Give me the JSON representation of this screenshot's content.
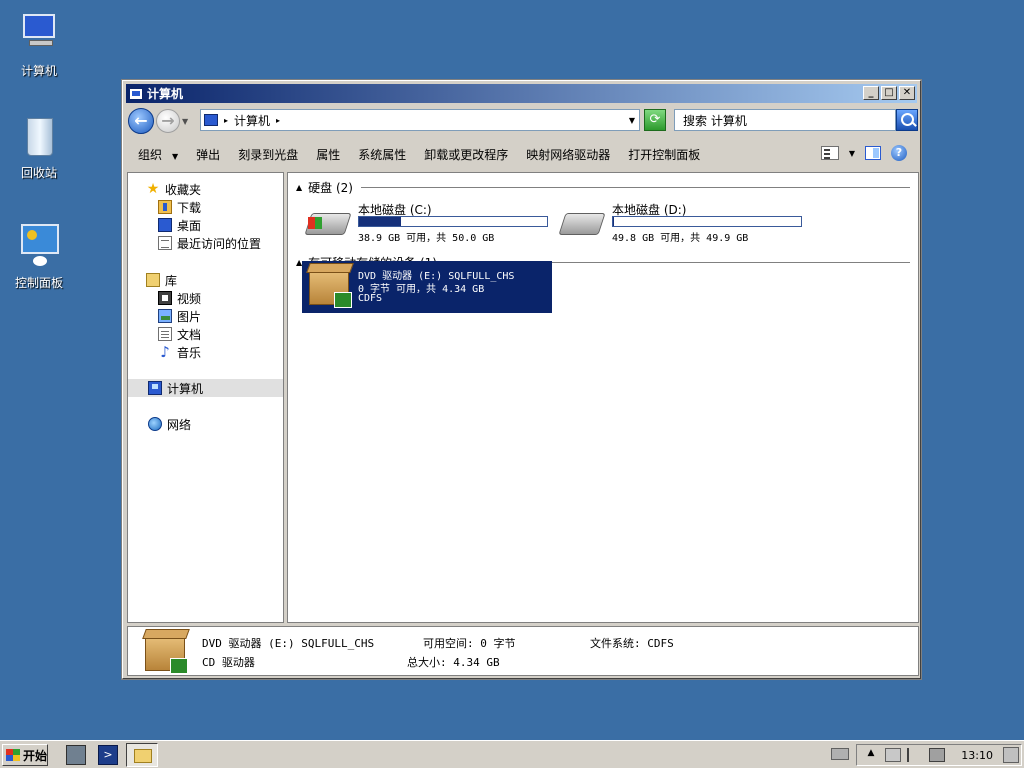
{
  "desktop": {
    "icons": [
      {
        "label": "计算机"
      },
      {
        "label": "回收站"
      },
      {
        "label": "控制面板"
      }
    ]
  },
  "window": {
    "title": "计算机",
    "controls": {
      "minimize": "_",
      "maximize": "□",
      "close": "✕"
    }
  },
  "address": {
    "path_label": "计算机",
    "search_placeholder": "搜索 计算机"
  },
  "commandbar": {
    "items": [
      "组织",
      "弹出",
      "刻录到光盘",
      "属性",
      "系统属性",
      "卸载或更改程序",
      "映射网络驱动器",
      "打开控制面板"
    ]
  },
  "navpane": {
    "favorites": {
      "label": "收藏夹",
      "items": [
        "下载",
        "桌面",
        "最近访问的位置"
      ]
    },
    "libraries": {
      "label": "库",
      "items": [
        "视频",
        "图片",
        "文档",
        "音乐"
      ]
    },
    "computer": "计算机",
    "network": "网络"
  },
  "content": {
    "hard_disks": {
      "header": "硬盘 (2)",
      "drives": [
        {
          "name": "本地磁盘 (C:)",
          "info": "38.9 GB 可用，共 50.0 GB",
          "used_fraction": 0.222
        },
        {
          "name": "本地磁盘 (D:)",
          "info": "49.8 GB 可用，共 49.9 GB",
          "used_fraction": 0.002
        }
      ]
    },
    "removable": {
      "header": "有可移动存储的设备 (1)",
      "dvd": {
        "line1": "DVD 驱动器 (E:) SQLFULL_CHS",
        "line2": "0 字节 可用，共 4.34 GB",
        "line3": "CDFS"
      }
    }
  },
  "details": {
    "title": "DVD 驱动器 (E:) SQLFULL_CHS",
    "free_label": "可用空间: 0 字节",
    "type": "CD 驱动器",
    "total_label": "总大小: 4.34 GB",
    "fs_label": "文件系统: CDFS"
  },
  "taskbar": {
    "start": "开始",
    "clock": "13:10"
  },
  "colors": {
    "desktop": "#3a6ea5",
    "title_gradient_start": "#0a246a",
    "selection": "#0a246a"
  }
}
